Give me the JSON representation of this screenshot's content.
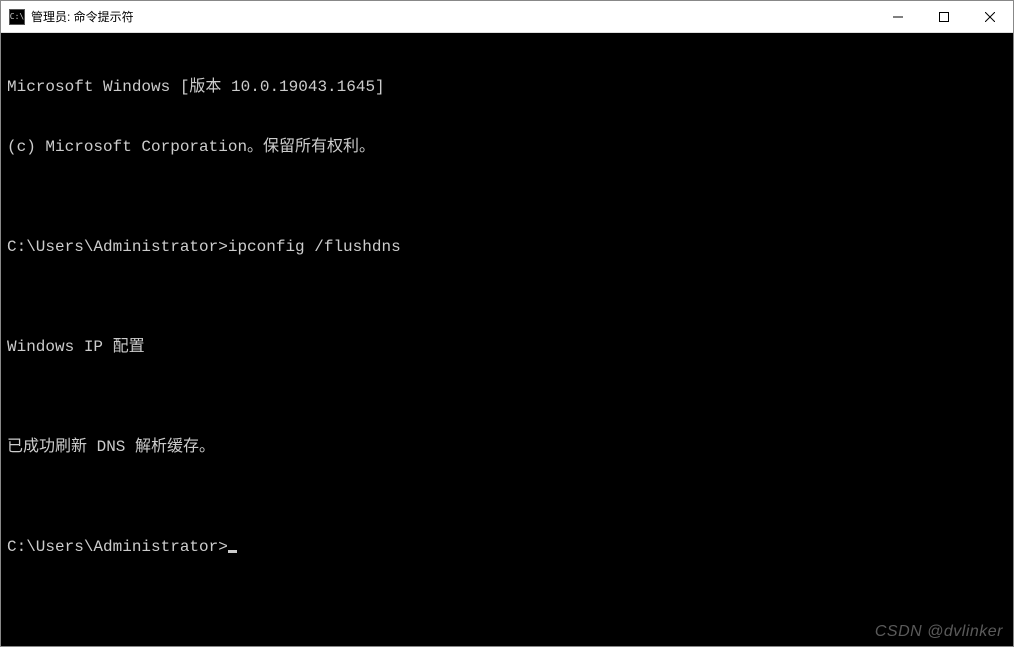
{
  "window": {
    "icon_text": "C:\\",
    "title": "管理员: 命令提示符"
  },
  "controls": {
    "minimize": "minimize",
    "maximize": "maximize",
    "close": "close"
  },
  "terminal": {
    "lines": [
      "Microsoft Windows [版本 10.0.19043.1645]",
      "(c) Microsoft Corporation。保留所有权利。",
      "",
      "C:\\Users\\Administrator>ipconfig /flushdns",
      "",
      "Windows IP 配置",
      "",
      "已成功刷新 DNS 解析缓存。",
      "",
      "C:\\Users\\Administrator>"
    ],
    "prompt_with_cursor_index": 9
  },
  "watermark": "CSDN @dvlinker"
}
